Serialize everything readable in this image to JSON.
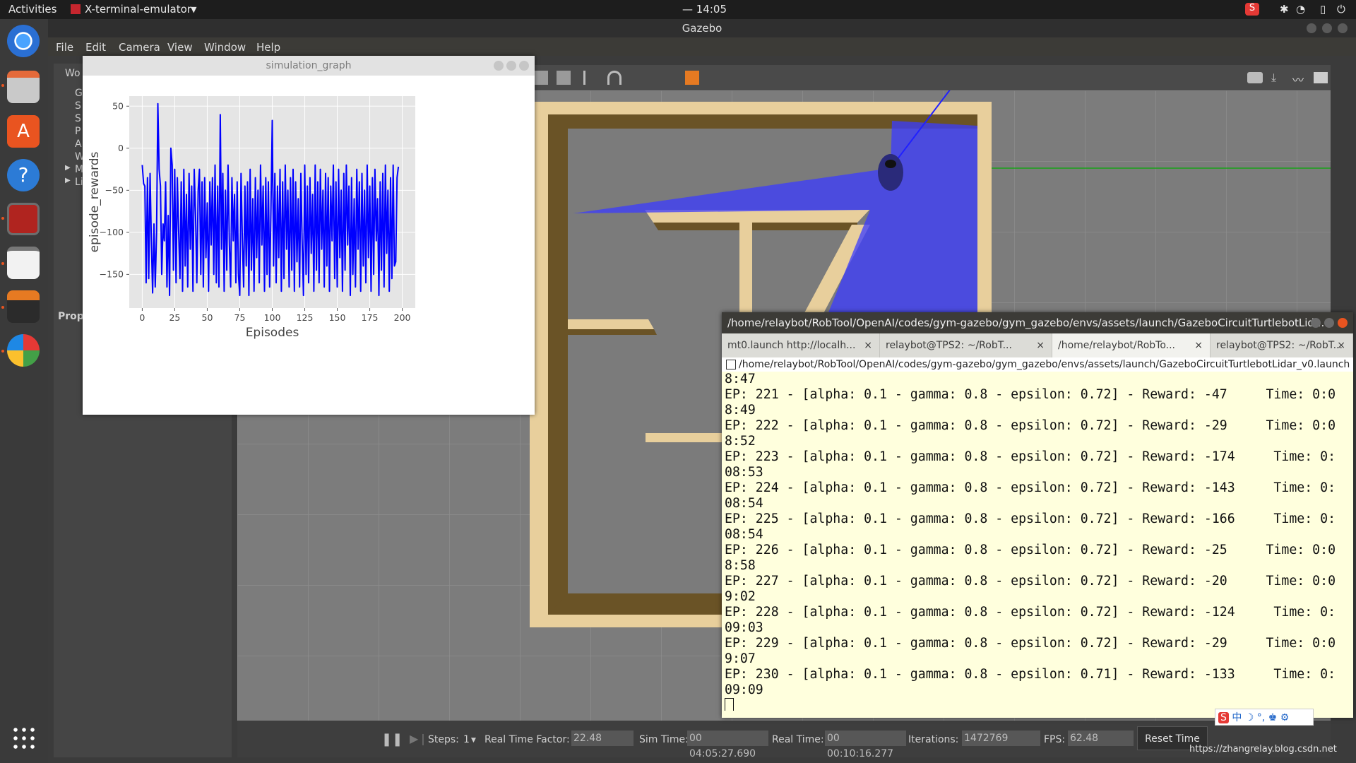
{
  "topbar": {
    "activities": "Activities",
    "app_name": "X-terminal-emulator",
    "clock": "— 14:05"
  },
  "launcher": {
    "items": [
      "chrome-icon",
      "files-icon",
      "software-center-icon",
      "help-icon",
      "terminal-icon",
      "text-editor-icon",
      "virtualbox-icon",
      "pinwheel-app-icon"
    ]
  },
  "gazebo": {
    "title": "Gazebo",
    "menu": [
      "File",
      "Edit",
      "Camera",
      "View",
      "Window",
      "Help"
    ],
    "left_panel": {
      "tab": "Wo",
      "items": [
        "G",
        "S",
        "S",
        "P",
        "A",
        "W",
        "M",
        "Li"
      ],
      "prop_label": "Prop"
    },
    "bottombar": {
      "steps_label": "Steps:",
      "steps_value": "1",
      "rtf_label": "Real Time Factor:",
      "rtf_value": "22.48",
      "sim_time_label": "Sim Time:",
      "sim_time_value": "00 04:05:27.690",
      "real_time_label": "Real Time:",
      "real_time_value": "00 00:10:16.277",
      "iterations_label": "Iterations:",
      "iterations_value": "1472769",
      "fps_label": "FPS:",
      "fps_value": "62.48",
      "reset_button": "Reset Time"
    },
    "watermark": "https://zhangrelay.blog.csdn.net"
  },
  "plot_window": {
    "title": "simulation_graph"
  },
  "chart_data": {
    "type": "line",
    "title": "",
    "xlabel": "Episodes",
    "ylabel": "episode_rewards",
    "xlim": [
      -10,
      210
    ],
    "ylim": [
      -190,
      62
    ],
    "xticks": [
      0,
      25,
      50,
      75,
      100,
      125,
      150,
      175,
      200
    ],
    "yticks": [
      50,
      0,
      -50,
      -100,
      -150
    ],
    "grid": true,
    "series_color": "#0000ff",
    "x": [
      0,
      1,
      2,
      3,
      4,
      5,
      6,
      7,
      8,
      9,
      10,
      11,
      12,
      13,
      14,
      15,
      16,
      17,
      18,
      19,
      20,
      21,
      22,
      23,
      24,
      25,
      26,
      27,
      28,
      29,
      30,
      31,
      32,
      33,
      34,
      35,
      36,
      37,
      38,
      39,
      40,
      41,
      42,
      43,
      44,
      45,
      46,
      47,
      48,
      49,
      50,
      51,
      52,
      53,
      54,
      55,
      56,
      57,
      58,
      59,
      60,
      61,
      62,
      63,
      64,
      65,
      66,
      67,
      68,
      69,
      70,
      71,
      72,
      73,
      74,
      75,
      76,
      77,
      78,
      79,
      80,
      81,
      82,
      83,
      84,
      85,
      86,
      87,
      88,
      89,
      90,
      91,
      92,
      93,
      94,
      95,
      96,
      97,
      98,
      99,
      100,
      101,
      102,
      103,
      104,
      105,
      106,
      107,
      108,
      109,
      110,
      111,
      112,
      113,
      114,
      115,
      116,
      117,
      118,
      119,
      120,
      121,
      122,
      123,
      124,
      125,
      126,
      127,
      128,
      129,
      130,
      131,
      132,
      133,
      134,
      135,
      136,
      137,
      138,
      139,
      140,
      141,
      142,
      143,
      144,
      145,
      146,
      147,
      148,
      149,
      150,
      151,
      152,
      153,
      154,
      155,
      156,
      157,
      158,
      159,
      160,
      161,
      162,
      163,
      164,
      165,
      166,
      167,
      168,
      169,
      170,
      171,
      172,
      173,
      174,
      175,
      176,
      177,
      178,
      179,
      180,
      181,
      182,
      183,
      184,
      185,
      186,
      187,
      188,
      189,
      190,
      191,
      192,
      193,
      194,
      195,
      196,
      197,
      198,
      199,
      200
    ],
    "y": [
      -20,
      -42,
      -45,
      -160,
      -35,
      -155,
      -30,
      -110,
      -172,
      -90,
      -165,
      -100,
      53,
      -25,
      -45,
      -150,
      -90,
      -110,
      -40,
      -165,
      -80,
      -175,
      0,
      -20,
      -145,
      -25,
      -160,
      -35,
      -100,
      -155,
      -40,
      -170,
      -25,
      -140,
      -55,
      -165,
      -30,
      -120,
      -45,
      -170,
      -25,
      -80,
      -160,
      -50,
      -25,
      -150,
      -40,
      -165,
      -35,
      -130,
      -65,
      -170,
      -40,
      -115,
      -35,
      -150,
      -20,
      -160,
      -45,
      -165,
      40,
      -120,
      -30,
      -170,
      -50,
      -145,
      -20,
      -115,
      -165,
      -35,
      -110,
      -55,
      -160,
      -40,
      -150,
      -175,
      -30,
      -110,
      -165,
      -45,
      -140,
      -40,
      -175,
      -25,
      -145,
      -60,
      -170,
      -35,
      -130,
      -50,
      -160,
      -20,
      -115,
      -45,
      -170,
      -35,
      -150,
      -40,
      -165,
      -70,
      33,
      -140,
      -30,
      -160,
      -45,
      -130,
      -25,
      -170,
      -40,
      -155,
      -20,
      -120,
      -50,
      -165,
      -35,
      -145,
      -25,
      -170,
      -40,
      -135,
      -60,
      -165,
      -30,
      -110,
      -175,
      -20,
      -150,
      -45,
      -160,
      -35,
      -125,
      -55,
      -170,
      -20,
      -145,
      -40,
      -160,
      -25,
      -120,
      -50,
      -165,
      -30,
      -140,
      -35,
      -170,
      -45,
      -110,
      -20,
      -155,
      -40,
      -165,
      -25,
      -130,
      -50,
      -170,
      -30,
      -145,
      -20,
      -115,
      -45,
      -175,
      -35,
      -150,
      -60,
      -165,
      -25,
      -120,
      -40,
      -170,
      -30,
      -140,
      -50,
      -160,
      -20,
      -130,
      -45,
      -170,
      -35,
      -150,
      -25,
      -110,
      -60,
      -175,
      -40,
      -145,
      -30,
      -165,
      -20,
      -125,
      -50,
      -170,
      -35,
      -155,
      -20,
      -140,
      -135,
      -35,
      -22
    ]
  },
  "terminal": {
    "title": "/home/relaybot/RobTool/OpenAI/codes/gym-gazebo/gym_gazebo/envs/assets/launch/GazeboCircuitTurtlebotLid...",
    "tabs": [
      "mt0.launch http://localh...",
      "relaybot@TPS2: ~/RobT...",
      "/home/relaybot/RobTo...",
      "relaybot@TPS2: ~/RobT..."
    ],
    "path_line": "/home/relaybot/RobTool/OpenAI/codes/gym-gazebo/gym_gazebo/envs/assets/launch/GazeboCircuitTurtlebotLidar_v0.launch ht",
    "lines": [
      "8:47",
      "EP: 221 - [alpha: 0.1 - gamma: 0.8 - epsilon: 0.72] - Reward: -47     Time: 0:0",
      "8:49",
      "EP: 222 - [alpha: 0.1 - gamma: 0.8 - epsilon: 0.72] - Reward: -29     Time: 0:0",
      "8:52",
      "EP: 223 - [alpha: 0.1 - gamma: 0.8 - epsilon: 0.72] - Reward: -174     Time: 0:",
      "08:53",
      "EP: 224 - [alpha: 0.1 - gamma: 0.8 - epsilon: 0.72] - Reward: -143     Time: 0:",
      "08:54",
      "EP: 225 - [alpha: 0.1 - gamma: 0.8 - epsilon: 0.72] - Reward: -166     Time: 0:",
      "08:54",
      "EP: 226 - [alpha: 0.1 - gamma: 0.8 - epsilon: 0.72] - Reward: -25     Time: 0:0",
      "8:58",
      "EP: 227 - [alpha: 0.1 - gamma: 0.8 - epsilon: 0.72] - Reward: -20     Time: 0:0",
      "9:02",
      "EP: 228 - [alpha: 0.1 - gamma: 0.8 - epsilon: 0.72] - Reward: -124     Time: 0:",
      "09:03",
      "EP: 229 - [alpha: 0.1 - gamma: 0.8 - epsilon: 0.72] - Reward: -29     Time: 0:0",
      "9:07",
      "EP: 230 - [alpha: 0.1 - gamma: 0.8 - epsilon: 0.71] - Reward: -133     Time: 0:",
      "09:09"
    ]
  }
}
